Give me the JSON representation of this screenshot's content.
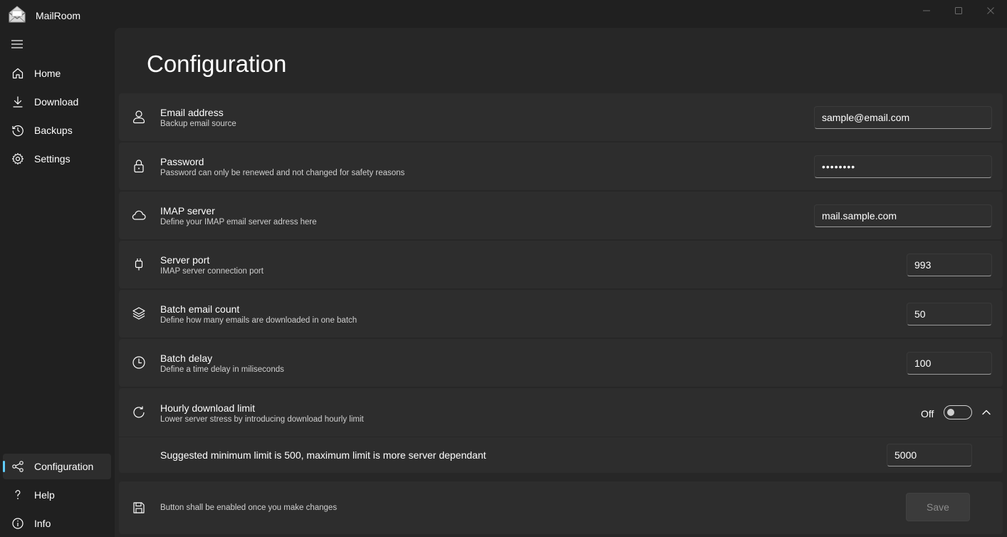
{
  "app": {
    "title": "MailRoom"
  },
  "nav": {
    "top": [
      {
        "label": "Home",
        "icon": "home-icon"
      },
      {
        "label": "Download",
        "icon": "download-icon"
      },
      {
        "label": "Backups",
        "icon": "history-icon"
      },
      {
        "label": "Settings",
        "icon": "gear-icon"
      }
    ],
    "bottom": [
      {
        "label": "Configuration",
        "icon": "share-nodes-icon",
        "active": true
      },
      {
        "label": "Help",
        "icon": "question-icon"
      },
      {
        "label": "Info",
        "icon": "info-icon"
      }
    ]
  },
  "page": {
    "title": "Configuration"
  },
  "settings": {
    "email": {
      "title": "Email address",
      "desc": "Backup email source",
      "value": "sample@email.com"
    },
    "password": {
      "title": "Password",
      "desc": "Password can only be renewed and not changed for safety reasons",
      "value": "••••••••"
    },
    "imap": {
      "title": "IMAP server",
      "desc": "Define your IMAP email server adress here",
      "value": "mail.sample.com"
    },
    "port": {
      "title": "Server port",
      "desc": "IMAP server connection port",
      "value": "993"
    },
    "batch_count": {
      "title": "Batch email count",
      "desc": "Define how many emails are downloaded in one batch",
      "value": "50"
    },
    "batch_delay": {
      "title": "Batch delay",
      "desc": "Define a time delay in miliseconds",
      "value": "100"
    },
    "hourly": {
      "title": "Hourly download limit",
      "desc": "Lower server stress by introducing download hourly limit",
      "toggle_label": "Off",
      "toggle_on": false,
      "expanded": true,
      "sub_text": "Suggested minimum limit is 500, maximum limit is more server dependant",
      "value": "5000"
    },
    "save": {
      "desc": "Button shall be enabled once you make changes",
      "label": "Save",
      "enabled": false
    }
  },
  "colors": {
    "accent": "#60cdff",
    "background": "#202020",
    "content": "#272727",
    "card": "#2d2d2d"
  }
}
